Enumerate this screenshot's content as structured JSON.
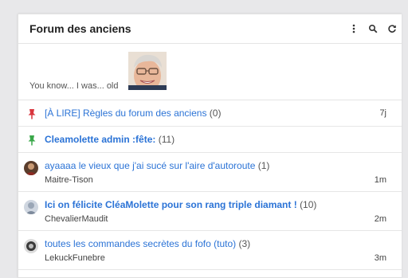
{
  "header": {
    "title": "Forum des anciens",
    "icons": [
      "more-vert-icon",
      "search-icon",
      "refresh-icon"
    ]
  },
  "banner": {
    "text": "You know... I was... old"
  },
  "topics": [
    {
      "title": "[À LIRE] Règles du forum des anciens",
      "count": "(0)",
      "time": "7j",
      "pin_color": "#d9363e"
    },
    {
      "title": "Cleamolette admin :fête:",
      "count": "(11)",
      "pin_color": "#3aa84a"
    },
    {
      "title": "ayaaaa le vieux que j'ai sucé sur l'aire d'autoroute",
      "count": "(1)",
      "author": "Maitre-Tison",
      "time": "1m"
    },
    {
      "title": "Ici on félicite CléaMolette pour son rang triple diamant !",
      "count": "(10)",
      "author": "ChevalierMaudit",
      "time": "2m"
    },
    {
      "title": "toutes les commandes secrètes du fofo (tuto)",
      "count": "(3)",
      "author": "LekuckFunebre",
      "time": "3m"
    }
  ],
  "colors": {
    "link": "#2b73d6",
    "pin_red": "#d9363e",
    "pin_green": "#3aa84a"
  }
}
